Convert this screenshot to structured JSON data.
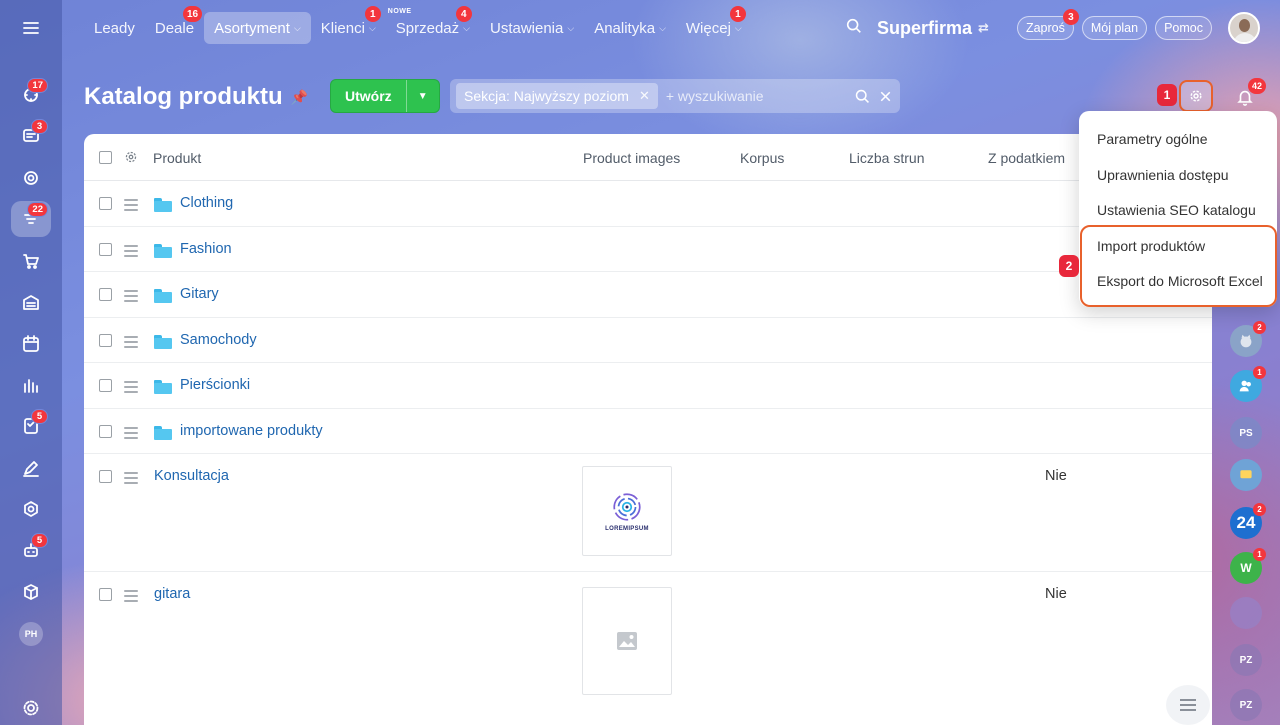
{
  "topmenu": {
    "items": [
      {
        "label": "Leady",
        "badge": ""
      },
      {
        "label": "Deale",
        "badge": "16"
      },
      {
        "label": "Asortyment",
        "badge": "",
        "active": true
      },
      {
        "label": "Klienci",
        "badge": "1"
      },
      {
        "label": "Sprzedaż",
        "badge": "4",
        "new": "NOWE"
      },
      {
        "label": "Ustawienia",
        "badge": ""
      },
      {
        "label": "Analityka",
        "badge": ""
      },
      {
        "label": "Więcej",
        "badge": "1"
      }
    ],
    "company": "Superfirma",
    "invite": {
      "label": "Zaproś",
      "badge": "3"
    },
    "plan": "Mój plan",
    "help": "Pomoc"
  },
  "sidebar": {
    "badges": {
      "activity": "17",
      "chat": "3",
      "crm": "22",
      "tasks": "5",
      "bots": "5"
    },
    "initials": "PH"
  },
  "page": {
    "title": "Katalog produktu",
    "create_label": "Utwórz",
    "filter_chip": "Sekcja: Najwyższy poziom",
    "search_placeholder": "+ wyszukiwanie",
    "notifications_badge": "42",
    "step1": "1",
    "step2": "2"
  },
  "table": {
    "columns": [
      "Produkt",
      "Product images",
      "Korpus",
      "Liczba strun",
      "Z podatkiem"
    ],
    "folders": [
      "Clothing",
      "Fashion",
      "Gitary",
      "Samochody",
      "Pierścionki",
      "importowane produkty"
    ],
    "products": [
      {
        "name": "Konsultacja",
        "tax": "Nie",
        "image_text": "LOREMIPSUM"
      },
      {
        "name": "gitara",
        "tax": "Nie",
        "image_text": ""
      }
    ]
  },
  "settings_menu": {
    "items": [
      "Parametry ogólne",
      "Uprawnienia dostępu",
      "Ustawienia SEO katalogu",
      "Import produktów",
      "Eksport do Microsoft Excel"
    ]
  },
  "rail": {
    "badges": [
      "2",
      "1",
      "2",
      "1"
    ],
    "initials": [
      "PS",
      "W",
      "PZ",
      "PZ"
    ],
    "b24": "24"
  },
  "colors": {
    "accent": "#2ec24f",
    "highlight": "#e8612c",
    "badge": "#f3363d",
    "link": "#2067b0"
  }
}
